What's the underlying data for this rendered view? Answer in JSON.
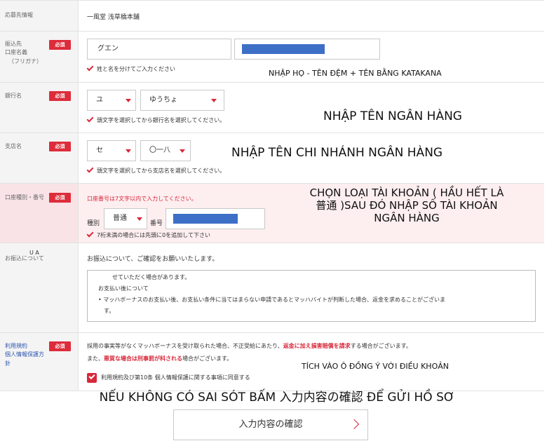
{
  "rows": {
    "company": {
      "label": "応募先情報",
      "value": "一風堂 浅草橋本舗"
    },
    "name": {
      "label": [
        "振込先",
        "口座名義",
        "（フリガナ）"
      ],
      "required": "必須",
      "last_name_value": "グエン",
      "hint": "姓と名を分けてご入力ください",
      "annotation": "NHẬP HỌ - TÊN ĐỆM + TÊN BẰNG KATAKANA"
    },
    "bank": {
      "label": "銀行名",
      "required": "必須",
      "initial_value": "ユ",
      "bank_value": "ゆうちょ",
      "hint": "頭文字を選択してから銀行名を選択してください。",
      "annotation": "NHẬP TÊN NGÂN HÀNG"
    },
    "branch": {
      "label": "支店名",
      "required": "必須",
      "initial_value": "セ",
      "branch_value": "〇一八",
      "hint": "頭文字を選択してから支店名を選択してください。",
      "annotation": "NHẬP TÊN CHI NHÁNH NGÂN HÀNG"
    },
    "account": {
      "label": "口座種別・番号",
      "required": "必須",
      "error": "口座番号は7文字以内で入力してください。",
      "type_label": "種別",
      "type_value": "普通",
      "number_label": "番号",
      "hint": "7桁未満の場合には先頭に0を追加して下さい",
      "annotation": [
        "CHỌN LOẠI TÀI KHOẢN ( HẦU HẾT LÀ",
        "普通 )\u0011SAU ĐÓ NHẬP SỐ TÀI KHOẢN",
        "NGÂN HÀNG"
      ]
    },
    "notice": {
      "label": "お振込について",
      "overlay": "U A",
      "intro": "お振込について、ご確認をお願いいたします。",
      "box_line1": "せていただく場合があります。",
      "box_line2": "お支払い後について",
      "box_line3": "マッハボーナスのお支払い後、お支払い条件に当てはまらない申請であるとマッハバイトが判断した場合、返金を求めることがございま",
      "box_line4": "す。"
    },
    "terms": {
      "label": [
        "利用規約",
        "個人情報保護方",
        "針"
      ],
      "required": "必須",
      "line1_a": "採用の事実等がなくマッハボーナスを受け取られた場合、不正受給にあたり、",
      "line1_b": "返金に加え損害賠償を請求",
      "line1_c": "する場合がございます。",
      "line2_a": "また、",
      "line2_b": "悪質な場合は刑事罰が科される",
      "line2_c": "場合がございます。",
      "agree_label": "利用規約及び第10条 個人情報保護に関する事項に同意する",
      "annotation": "TÍCH VÀO Ô ĐỒNG Ý VỚI ĐIỀU KHOẢN"
    }
  },
  "bottom_annotation": "NẾU KHÔNG CÓ SAI SÓT BẤM 入力内容の確認 ĐỂ GỬI HỒ SƠ",
  "confirm_button": "入力内容の確認",
  "colors": {
    "accent": "#d8283a",
    "redacted": "#3d6fc7",
    "error_bg": "#fdeef0"
  }
}
